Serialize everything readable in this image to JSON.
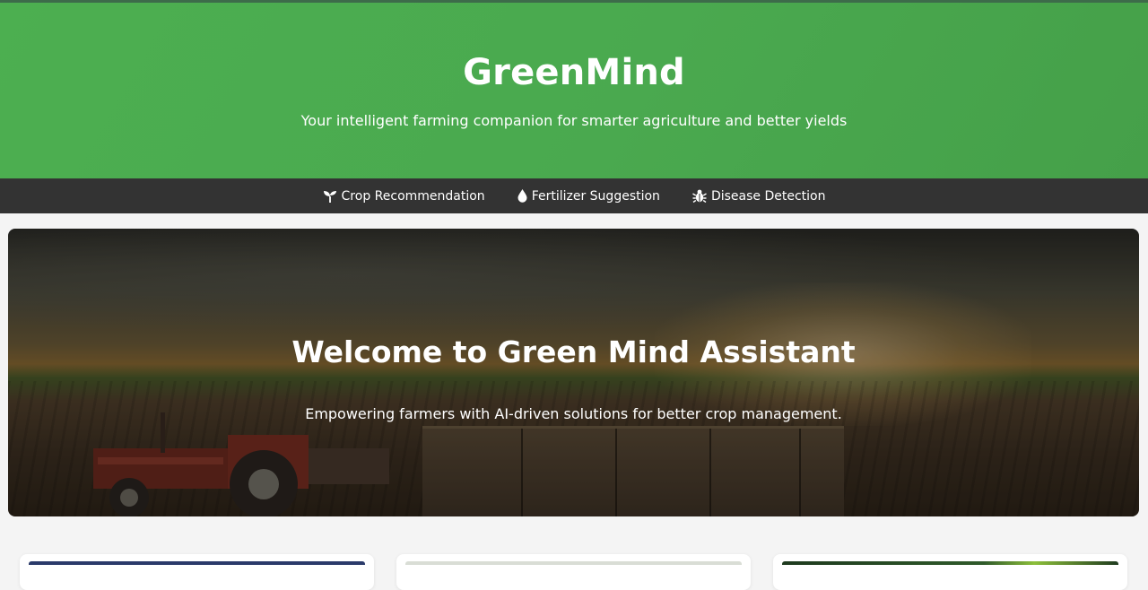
{
  "header": {
    "title": "GreenMind",
    "tagline": "Your intelligent farming companion for smarter agriculture and better yields"
  },
  "nav": {
    "items": [
      {
        "label": "Crop Recommendation",
        "icon": "seedling-icon"
      },
      {
        "label": "Fertilizer Suggestion",
        "icon": "droplet-icon"
      },
      {
        "label": "Disease Detection",
        "icon": "bug-icon"
      }
    ]
  },
  "hero": {
    "title": "Welcome to Green Mind Assistant",
    "subtitle": "Empowering farmers with AI-driven solutions for better crop management."
  },
  "colors": {
    "brand_green": "#4caf50",
    "nav_background": "#333333",
    "page_background": "#f4f4f4"
  }
}
